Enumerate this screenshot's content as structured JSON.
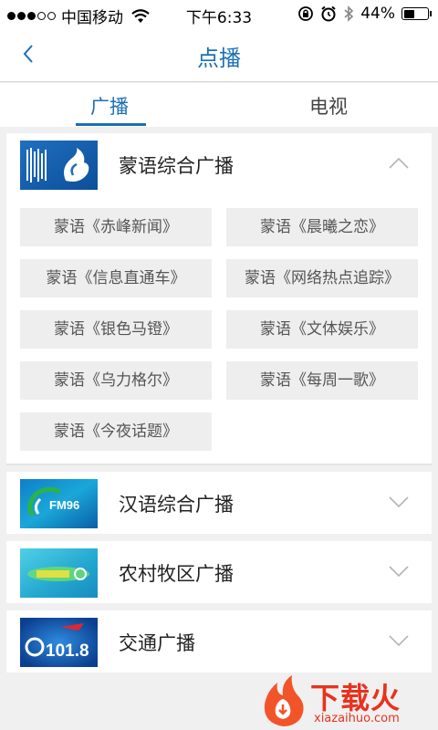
{
  "status_bar": {
    "carrier": "中国移动",
    "time": "下午6:33",
    "battery": "44%",
    "battery_level": 0.44,
    "signal_dots_filled": 3,
    "signal_dots_total": 5
  },
  "header": {
    "back_icon": "chevron-left-icon",
    "title": "点播"
  },
  "tabs": [
    {
      "label": "广播",
      "active": true
    },
    {
      "label": "电视",
      "active": false
    }
  ],
  "stations": [
    {
      "name": "蒙语综合广播",
      "expanded": true,
      "programs": [
        "蒙语《赤峰新闻》",
        "蒙语《晨曦之恋》",
        "蒙语《信息直通车》",
        "蒙语《网络热点追踪》",
        "蒙语《银色马镫》",
        "蒙语《文体娱乐》",
        "蒙语《乌力格尔》",
        "蒙语《每周一歌》",
        "蒙语《今夜话题》"
      ]
    },
    {
      "name": "汉语综合广播",
      "expanded": false
    },
    {
      "name": "农村牧区广播",
      "expanded": false
    },
    {
      "name": "交通广播",
      "expanded": false
    }
  ],
  "logo_texts": {
    "fm96": "FM96",
    "traffic": "101.8"
  },
  "watermark": {
    "text": "下载火",
    "url": "xiazaihuo.com"
  },
  "colors": {
    "accent": "#1b6fb5",
    "background": "#f0f0f0",
    "program_bg": "#eeeeee",
    "watermark": "#e8321e"
  }
}
